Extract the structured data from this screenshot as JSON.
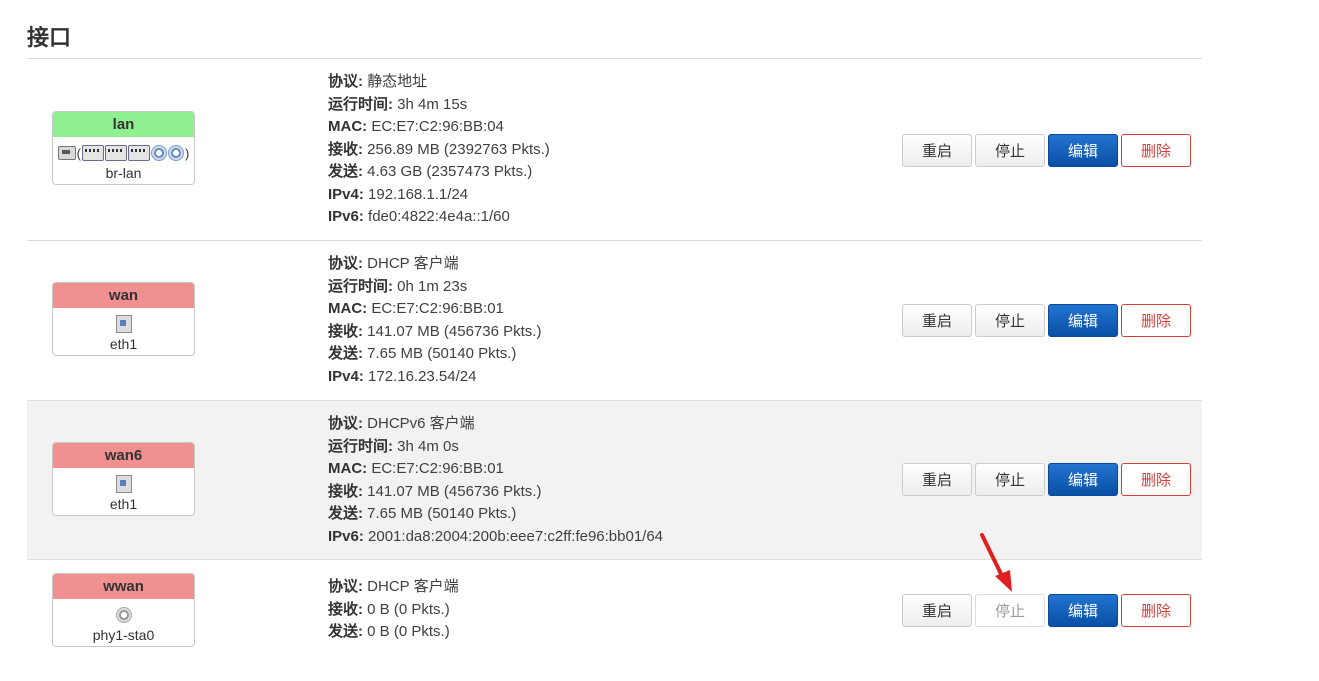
{
  "page": {
    "title": "接口"
  },
  "labels": {
    "protocol": "协议:",
    "uptime": "运行时间:",
    "mac": "MAC:",
    "rx": "接收:",
    "tx": "发送:",
    "ipv4": "IPv4:",
    "ipv6": "IPv6:"
  },
  "buttons": {
    "restart": "重启",
    "stop": "停止",
    "edit": "编辑",
    "delete": "删除"
  },
  "colors": {
    "up_badge": "#90f090",
    "down_badge": "#f09090",
    "primary": "#0a4fa5",
    "danger": "#d43f3a",
    "annotation_arrow": "#e02020"
  },
  "interfaces": [
    {
      "name": "lan",
      "device": "br-lan",
      "badge_color": "green",
      "icons": [
        "ethernet-port-icon",
        "(",
        "bridge-port-icon",
        "bridge-port-icon",
        "bridge-port-icon",
        "wifi-icon",
        "wifi-icon",
        ")"
      ],
      "paren_open": "(",
      "paren_close": ")",
      "protocol": "静态地址",
      "uptime": "3h 4m 15s",
      "mac": "EC:E7:C2:96:BB:04",
      "rx": "256.89 MB (2392763 Pkts.)",
      "tx": "4.63 GB (2357473 Pkts.)",
      "ipv4": "192.168.1.1/24",
      "ipv6": "fde0:4822:4e4a::1/60"
    },
    {
      "name": "wan",
      "device": "eth1",
      "badge_color": "red",
      "protocol": "DHCP 客户端",
      "uptime": "0h 1m 23s",
      "mac": "EC:E7:C2:96:BB:01",
      "rx": "141.07 MB (456736 Pkts.)",
      "tx": "7.65 MB (50140 Pkts.)",
      "ipv4": "172.16.23.54/24"
    },
    {
      "name": "wan6",
      "device": "eth1",
      "badge_color": "red",
      "protocol": "DHCPv6 客户端",
      "uptime": "3h 4m 0s",
      "mac": "EC:E7:C2:96:BB:01",
      "rx": "141.07 MB (456736 Pkts.)",
      "tx": "7.65 MB (50140 Pkts.)",
      "ipv6": "2001:da8:2004:200b:eee7:c2ff:fe96:bb01/64"
    },
    {
      "name": "wwan",
      "device": "phy1-sta0",
      "badge_color": "red",
      "protocol": "DHCP 客户端",
      "rx": "0 B (0 Pkts.)",
      "tx": "0 B (0 Pkts.)",
      "stop_disabled": true
    }
  ]
}
